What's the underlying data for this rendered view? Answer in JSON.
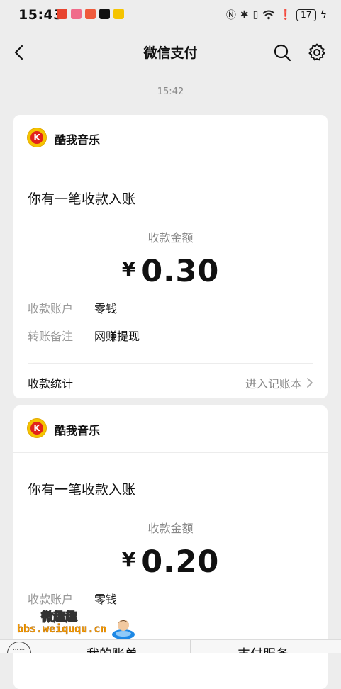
{
  "status_bar": {
    "time": "15:43",
    "battery": "17",
    "app_icons": [
      {
        "icon": "app-icon-red",
        "color": "#e8442e"
      },
      {
        "icon": "app-icon-pink",
        "color": "#f06b8a"
      },
      {
        "icon": "app-icon-orange",
        "color": "#ef5a3b"
      },
      {
        "icon": "tiktok-icon",
        "color": "#111111"
      },
      {
        "icon": "app-icon-yellow",
        "color": "#f5c400"
      }
    ]
  },
  "nav": {
    "title": "微信支付"
  },
  "timestamp": "15:42",
  "cards": [
    {
      "merchant": "酷我音乐",
      "heading": "你有一笔收款入账",
      "amount_label": "收款金额",
      "currency": "¥",
      "amount": "0.30",
      "fields": [
        {
          "label": "收款账户",
          "value": "零钱"
        },
        {
          "label": "转账备注",
          "value": "网赚提现"
        }
      ],
      "footer_left": "收款统计",
      "footer_right": "进入记账本"
    },
    {
      "merchant": "酷我音乐",
      "heading": "你有一笔收款入账",
      "amount_label": "收款金额",
      "currency": "¥",
      "amount": "0.20",
      "fields": [
        {
          "label": "收款账户",
          "value": "零钱"
        }
      ]
    }
  ],
  "watermark": {
    "brand": "微趣趣",
    "url": "bbs.weiququ.cn"
  },
  "bottom_bar": {
    "tabs": [
      "我的账单",
      "支付服务"
    ]
  },
  "colors": {
    "background": "#ededed",
    "card": "#ffffff",
    "logo_yellow": "#f5c400",
    "logo_red": "#e2231a",
    "watermark_orange": "#f39800"
  }
}
